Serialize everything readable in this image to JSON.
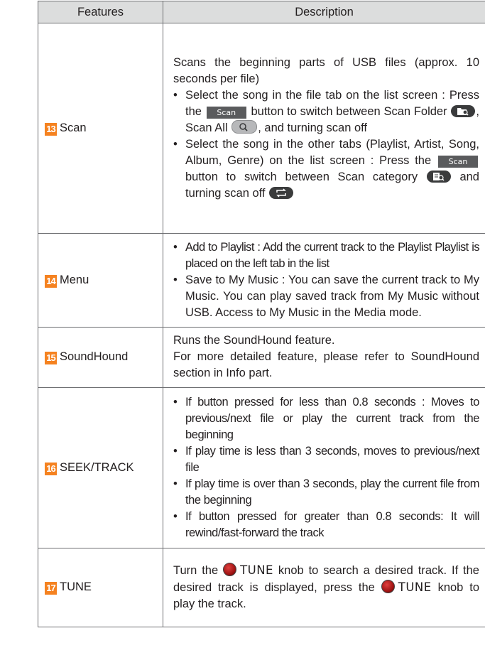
{
  "header": {
    "features": "Features",
    "description": "Description"
  },
  "rows": [
    {
      "num": "13",
      "feature": "Scan",
      "intro": "Scans the beginning parts of USB files (approx. 10 seconds per file)",
      "b1_a": "Select the song in the file tab on the list screen : Press the",
      "b1_b": "button to switch between Scan Folder",
      "b1_c": ", Scan All",
      "b1_d": ", and turning scan off",
      "b2_a": "Select the song in the other tabs (Playlist, Artist, Song, Album, Genre) on the list screen : Press the",
      "b2_b": "button to switch between Scan category",
      "b2_c": "and turning scan off",
      "scan_button_label": "Scan",
      "icons": [
        "scan-folder-icon",
        "scan-all-icon",
        "scan-category-icon",
        "scan-off-icon"
      ]
    },
    {
      "num": "14",
      "feature": "Menu",
      "b1": "Add to Playlist : Add the current track to the Playlist Playlist is placed on the left tab in the list",
      "b2": "Save to My Music : You can save the current track to My Music. You can play saved track from My Music without USB.  Access to My Music in the Media mode."
    },
    {
      "num": "15",
      "feature": "SoundHound",
      "line1": "Runs the SoundHound feature.",
      "line2": "For more detailed feature, please refer to SoundHound section in Info part."
    },
    {
      "num": "16",
      "feature": "SEEK/TRACK",
      "b1": "If button pressed for less than 0.8 seconds : Moves to previous/next file or play the current track from the beginning",
      "b2": "If play time is less than 3 seconds, moves to previous/next file",
      "b3": "If play time is over than 3 seconds, play the current file from the beginning",
      "b4": "If button pressed for greater than 0.8 seconds: It will rewind/fast-forward the track"
    },
    {
      "num": "17",
      "feature": "TUNE",
      "t_a": "Turn the",
      "tune1": "TUNE",
      "t_b": "knob to search a desired track. If the desired track is displayed, press the",
      "tune2": "TUNE",
      "t_c": "knob to play the track."
    }
  ],
  "colors": {
    "number_badge": "#f58220",
    "header_bg": "#dcdddd",
    "border": "#6d6e71",
    "knob": "#c0201e"
  }
}
